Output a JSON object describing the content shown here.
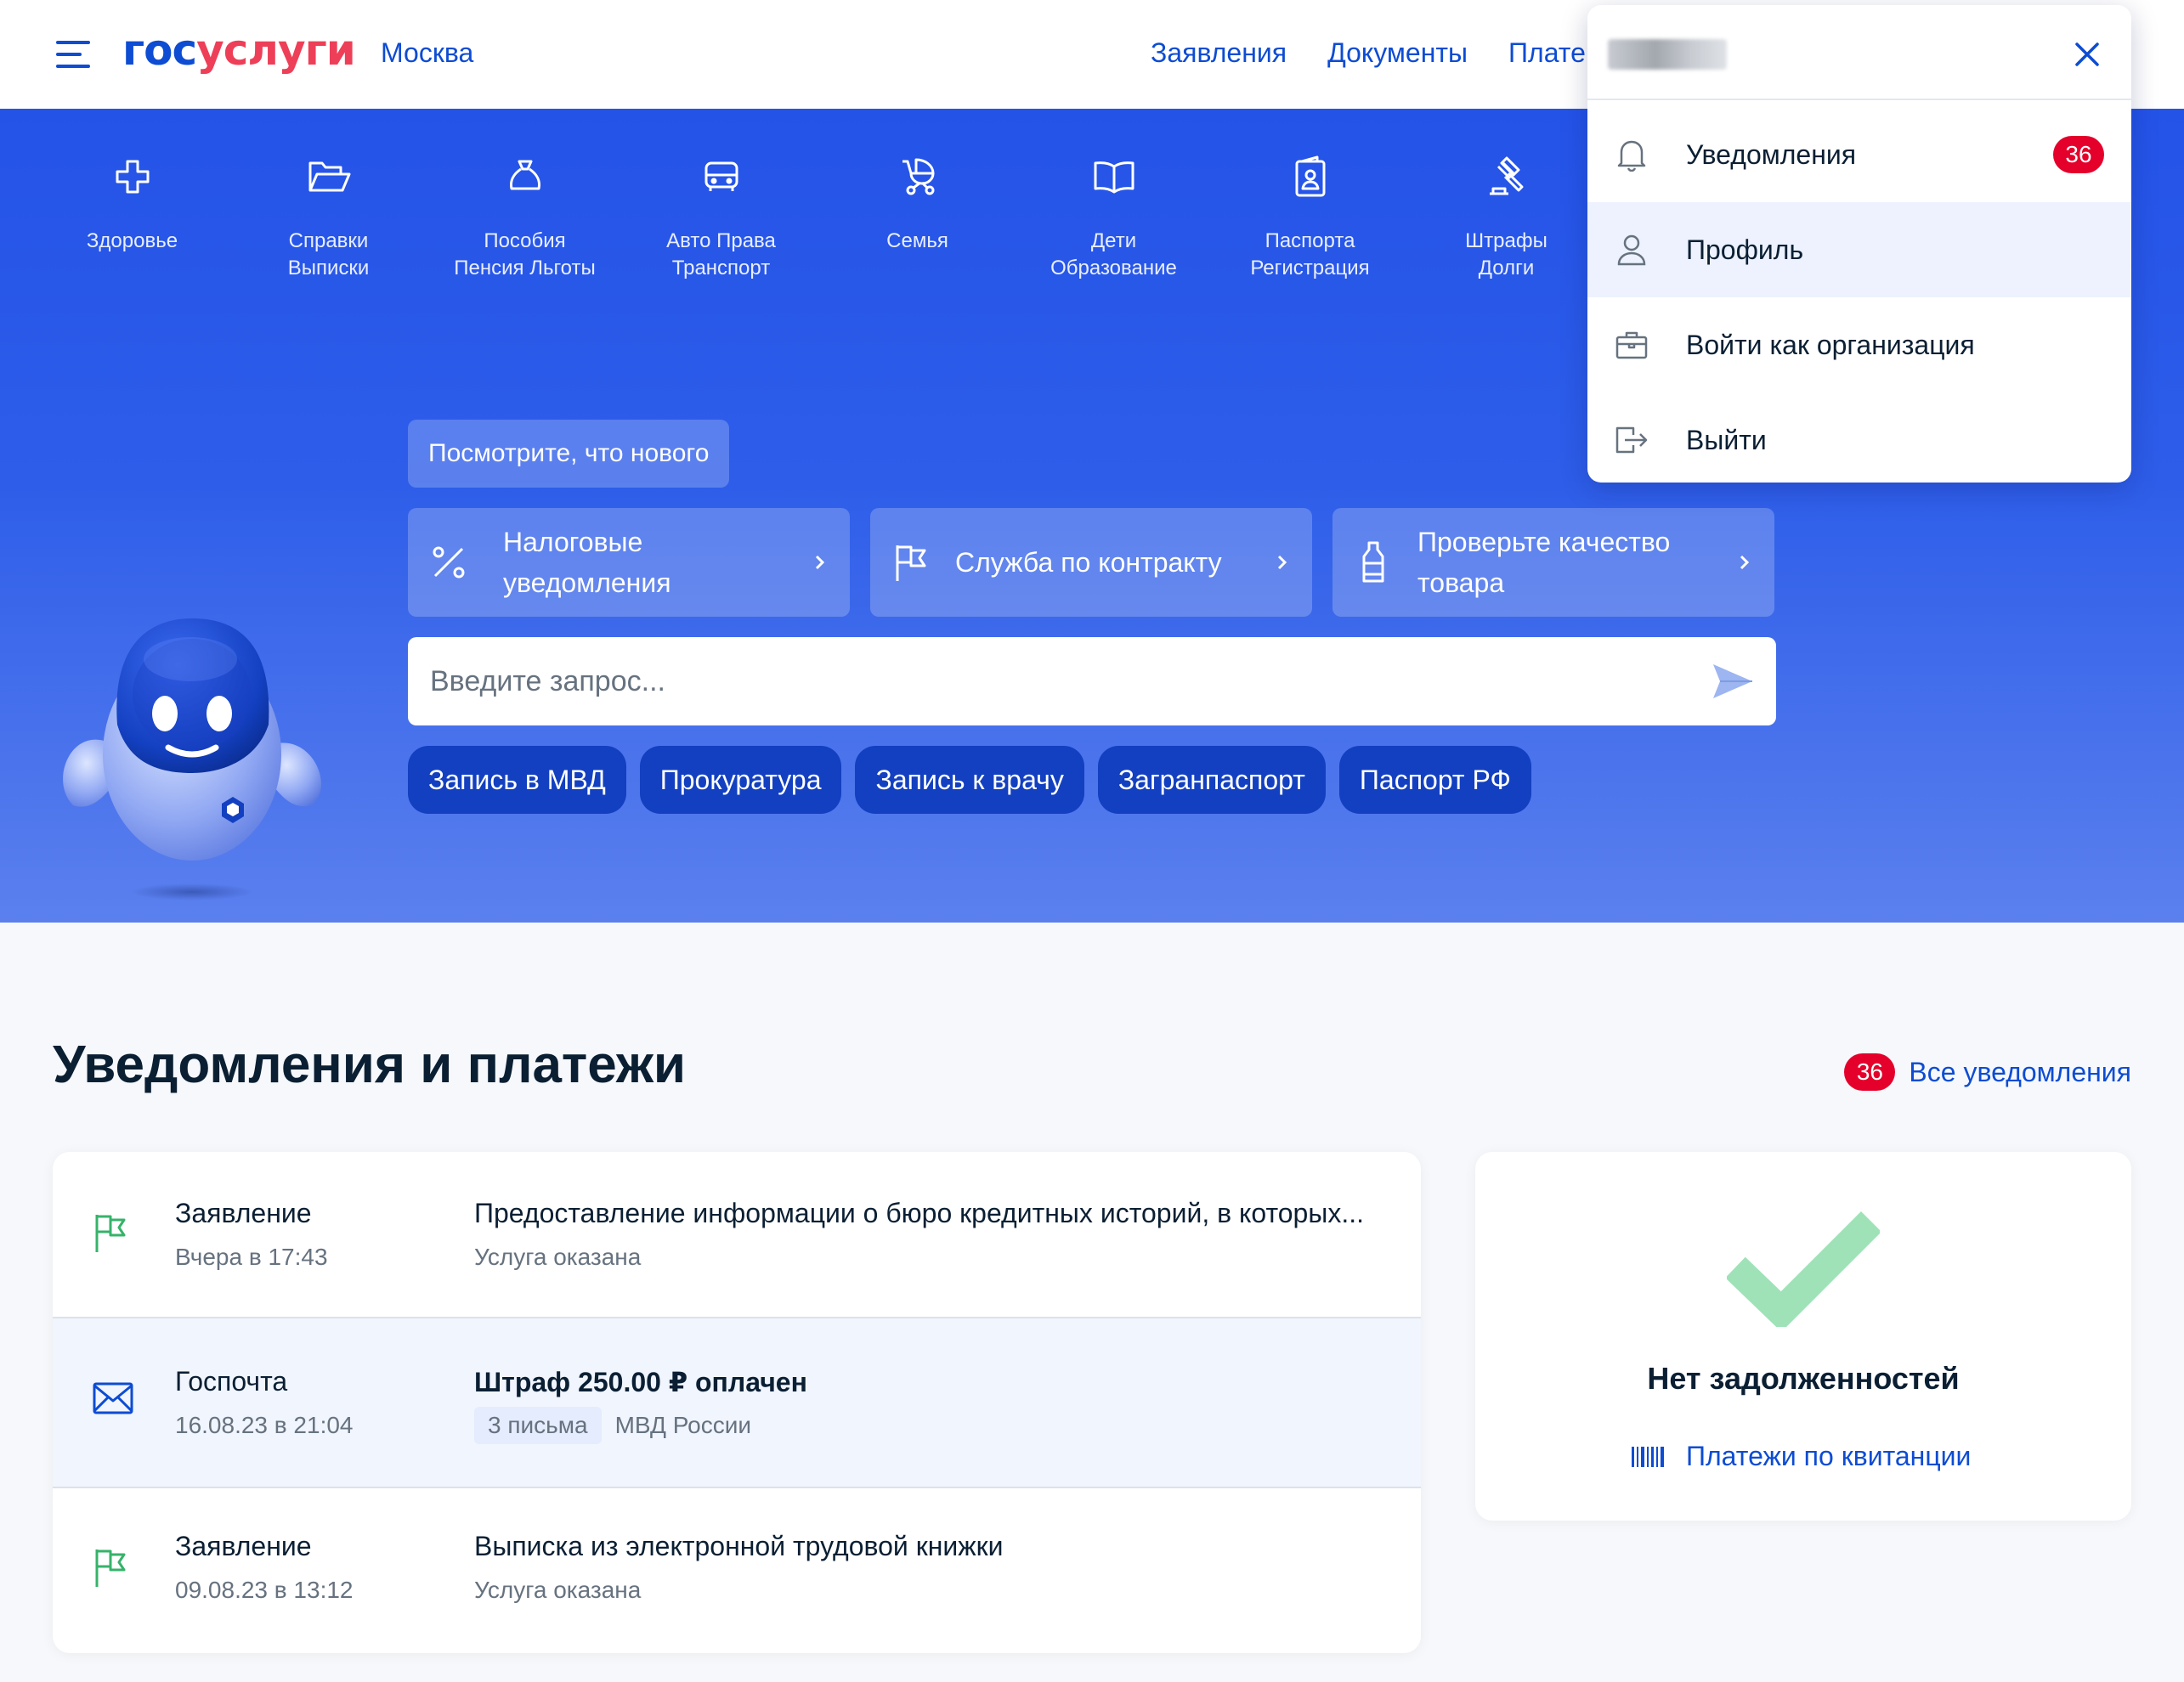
{
  "header": {
    "logo_part1": "гос",
    "logo_part2": "услуги",
    "city": "Москва",
    "nav": [
      "Заявления",
      "Документы",
      "Плате"
    ]
  },
  "categories": [
    {
      "label": "Здоровье",
      "icon": "plus-icon"
    },
    {
      "label": "Справки\nВыписки",
      "icon": "folder-icon"
    },
    {
      "label": "Пособия\nПенсия Льготы",
      "icon": "money-bag-icon"
    },
    {
      "label": "Авто Права\nТранспорт",
      "icon": "car-icon"
    },
    {
      "label": "Семья",
      "icon": "stroller-icon"
    },
    {
      "label": "Дети\nОбразование",
      "icon": "book-icon"
    },
    {
      "label": "Паспорта\nРегистрация",
      "icon": "passport-icon"
    },
    {
      "label": "Штрафы\nДолги",
      "icon": "gavel-icon"
    }
  ],
  "hero": {
    "whats_new": "Посмотрите, что нового",
    "promos": [
      {
        "label": "Налоговые уведомления",
        "icon": "percent-icon"
      },
      {
        "label": "Служба по контракту",
        "icon": "flag-icon"
      },
      {
        "label": "Проверьте качество товара",
        "icon": "bottle-icon"
      }
    ],
    "search_placeholder": "Введите запрос...",
    "chips": [
      "Запись в МВД",
      "Прокуратура",
      "Запись к врачу",
      "Загранпаспорт",
      "Паспорт РФ"
    ]
  },
  "notifications": {
    "title": "Уведомления и платежи",
    "count": "36",
    "all_link": "Все уведомления",
    "items": [
      {
        "type": "Заявление",
        "date": "Вчера в 17:43",
        "title": "Предоставление информации о бюро кредитных историй, в которых...",
        "status": "Услуга оказана",
        "icon": "flag-icon"
      },
      {
        "type": "Госпочта",
        "date": "16.08.23 в 21:04",
        "title": "Штраф 250.00 ₽ оплачен",
        "tag": "3 письма",
        "status": "МВД России",
        "icon": "envelope-icon"
      },
      {
        "type": "Заявление",
        "date": "09.08.23 в 13:12",
        "title": "Выписка из электронной трудовой книжки",
        "status": "Услуга оказана",
        "icon": "flag-icon"
      }
    ]
  },
  "debt": {
    "title": "Нет задолженностей",
    "link": "Платежи по квитанции"
  },
  "dropdown": {
    "items": [
      {
        "label": "Уведомления",
        "icon": "bell-icon",
        "badge": "36"
      },
      {
        "label": "Профиль",
        "icon": "user-icon",
        "active": true
      },
      {
        "label": "Войти как организация",
        "icon": "briefcase-icon"
      },
      {
        "label": "Выйти",
        "icon": "logout-icon"
      }
    ]
  },
  "colors": {
    "brand_blue": "#0d4cd3",
    "brand_red": "#ee3f58",
    "hero_blue": "#2453e8",
    "badge_red": "#e4002b",
    "success_green": "#9fe2b8",
    "flag_green": "#36b36a"
  }
}
